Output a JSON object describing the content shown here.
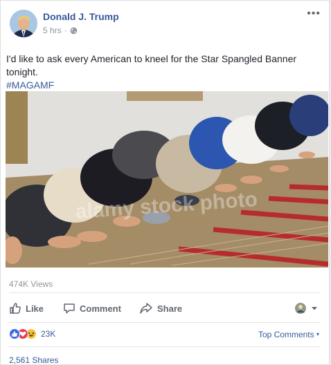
{
  "post": {
    "author": "Donald J. Trump",
    "time": "5 hrs",
    "more_label": "•••",
    "text": "I'd like to ask every American to kneel for the Star Spangled Banner tonight.",
    "hashtag": "#MAGAMF",
    "photo_watermark": "alamy stock photo"
  },
  "stats": {
    "views": "474K Views",
    "reaction_count": "23K",
    "reaction_icons": [
      "like-icon",
      "love-icon",
      "haha-icon"
    ],
    "shares": "2,561 Shares"
  },
  "actions": {
    "like": "Like",
    "comment": "Comment",
    "share": "Share"
  },
  "comments": {
    "sort_label": "Top Comments"
  },
  "colors": {
    "link": "#365899",
    "muted": "#90949c",
    "action": "#606770",
    "like_blue": "#3b6ae3",
    "love_red": "#e63d50",
    "haha_yellow": "#f5c33b"
  }
}
